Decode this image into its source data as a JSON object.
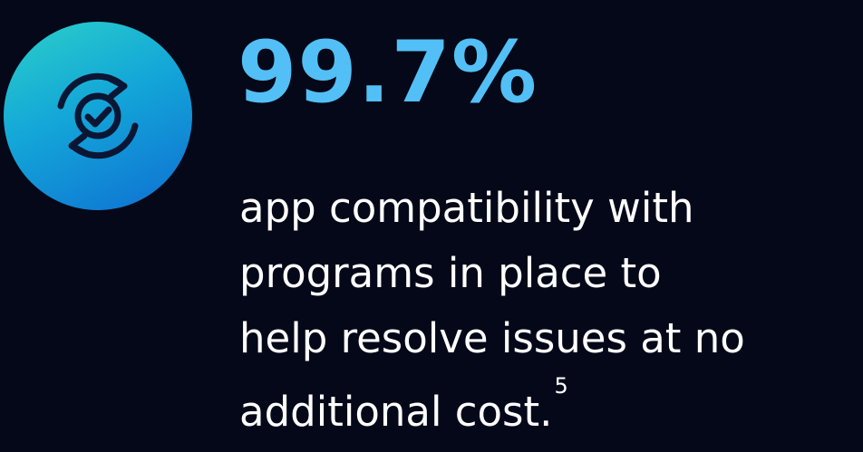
{
  "badge": {
    "icon": "sync-check-icon",
    "gradient": [
      "#2bd0c9",
      "#13a6d8",
      "#0f6fd2"
    ],
    "icon_color": "#0a1633"
  },
  "stat": {
    "value": "99.7%",
    "color": "#52c0f6"
  },
  "description": {
    "lines": [
      "app compatibility with",
      "programs in place to",
      "help resolve issues at no",
      "additional cost."
    ],
    "footnote": "5"
  },
  "colors": {
    "background": "#050818",
    "text": "#ffffff"
  }
}
